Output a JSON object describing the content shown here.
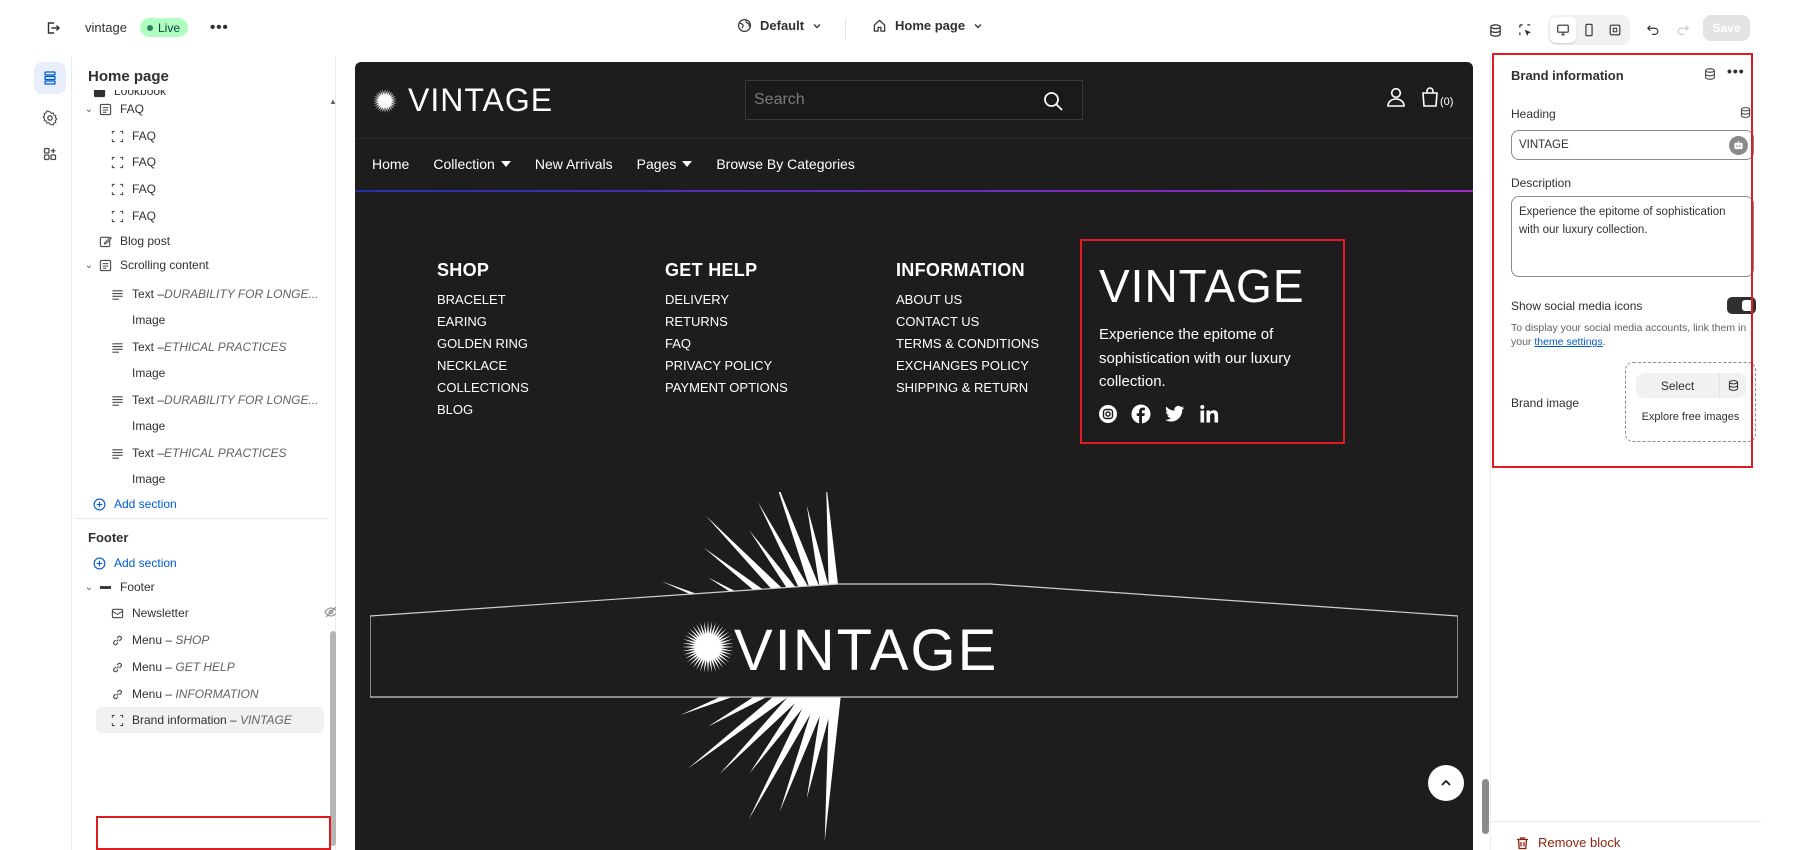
{
  "topbar": {
    "store_name": "vintage",
    "status": "Live",
    "more": "•••",
    "theme": "Default",
    "page": "Home page",
    "save": "Save"
  },
  "sidebar": {
    "title": "Home page",
    "items": [
      {
        "label": "Lookbook"
      },
      {
        "label": "FAQ"
      },
      {
        "label": "FAQ"
      },
      {
        "label": "FAQ"
      },
      {
        "label": "FAQ"
      },
      {
        "label": "FAQ"
      },
      {
        "label": "Blog post"
      },
      {
        "label": "Scrolling content"
      },
      {
        "label": "Text – ",
        "sub": "DURABILITY FOR LONGE..."
      },
      {
        "label": "Image"
      },
      {
        "label": "Text – ",
        "sub": "ETHICAL PRACTICES"
      },
      {
        "label": "Image"
      },
      {
        "label": "Text – ",
        "sub": "DURABILITY FOR LONGE..."
      },
      {
        "label": "Image"
      },
      {
        "label": "Text – ",
        "sub": "ETHICAL PRACTICES"
      },
      {
        "label": "Image"
      }
    ],
    "add_section": "Add section",
    "footer_heading": "Footer",
    "footer_add_section": "Add section",
    "footer_group": "Footer",
    "footer_items": [
      {
        "label": "Newsletter"
      },
      {
        "label": "Menu – ",
        "sub": "SHOP"
      },
      {
        "label": "Menu – ",
        "sub": "GET HELP"
      },
      {
        "label": "Menu – ",
        "sub": "INFORMATION"
      },
      {
        "label": "Brand information – ",
        "sub": "VINTAGE"
      }
    ]
  },
  "preview": {
    "logo": "VINTAGE",
    "search_placeholder": "Search",
    "cart_count": "(0)",
    "nav": [
      "Home",
      "Collection",
      "New Arrivals",
      "Pages",
      "Browse By Categories"
    ],
    "columns": [
      {
        "heading": "SHOP",
        "links": [
          "BRACELET",
          "EARING",
          "GOLDEN RING",
          "NECKLACE",
          "COLLECTIONS",
          "BLOG"
        ]
      },
      {
        "heading": "GET HELP",
        "links": [
          "DELIVERY",
          "RETURNS",
          "FAQ",
          "PRIVACY POLICY",
          "PAYMENT OPTIONS"
        ]
      },
      {
        "heading": "INFORMATION",
        "links": [
          "ABOUT US",
          "CONTACT US",
          "TERMS & CONDITIONS",
          "EXCHANGES POLICY",
          "SHIPPING & RETURN"
        ]
      }
    ],
    "brand_heading": "VINTAGE",
    "brand_description": "Experience the epitome of sophistication with our luxury collection.",
    "big_logo": "VINTAGE"
  },
  "panel": {
    "title": "Brand information",
    "heading_label": "Heading",
    "heading_value": "VINTAGE",
    "description_label": "Description",
    "description_value": "Experience the epitome of sophistication with our luxury collection.",
    "social_label": "Show social media icons",
    "social_enabled": true,
    "help_prefix": "To display your social media accounts, link them in your ",
    "help_link": "theme settings",
    "help_suffix": ".",
    "brand_image_label": "Brand image",
    "select": "Select",
    "explore": "Explore free images",
    "remove": "Remove block"
  },
  "colors": {
    "accent": "#005bd3",
    "highlight": "#e21b22",
    "live_bg": "#affebf",
    "preview_bg": "#1d1d1d",
    "remove": "#8e1f0b"
  }
}
